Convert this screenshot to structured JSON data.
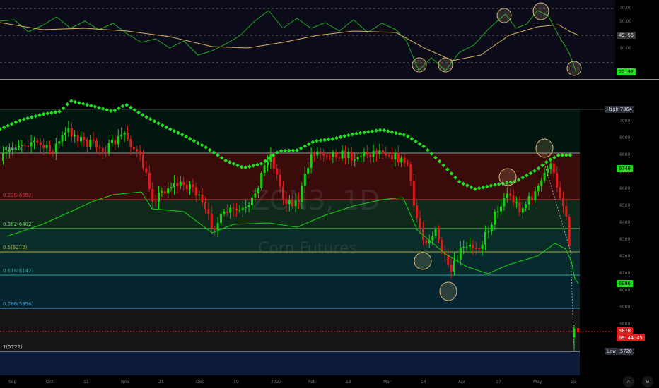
{
  "watermark": {
    "ticker": "ZCN3, 1D",
    "name": "Corn Futures"
  },
  "colors": {
    "up": "#12d512",
    "down": "#e01919",
    "supertrend": "#20e020",
    "rsi": "#22aa22",
    "rsi_ma": "#d9b060",
    "circle": "#d2b87a"
  },
  "fib_levels": [
    {
      "label": "0(6840)",
      "band": "#3a0b0b",
      "line": "#999999"
    },
    {
      "label": "0.236(6562)",
      "band": "#0f2a1b",
      "line": "#cc3a3a"
    },
    {
      "label": "0.382(6402)",
      "band": "#0b2d2a",
      "line": "#6fcf6f"
    },
    {
      "label": "0.5(6272)",
      "band": "#062a2e",
      "line": "#a9a93a"
    },
    {
      "label": "0.618(6142)",
      "band": "#072530",
      "line": "#26a69a"
    },
    {
      "label": "0.786(5956)",
      "band": "#151515",
      "line": "#4d9fcf"
    },
    {
      "label": "1(5722)",
      "band": "#0c1b3a",
      "line": "#cccccc"
    }
  ],
  "right_tags": {
    "high": {
      "name": "High",
      "value": "7064"
    },
    "supertrend_value": "6740",
    "ma_value": "6096",
    "last_price": "5870",
    "countdown": "09:44:45",
    "low": {
      "name": "Low",
      "value": "5720"
    },
    "rsi_ma_value": "49.56",
    "rsi_value": "22.92"
  },
  "price_axis_ticks": [
    "7000",
    "6900",
    "6800",
    "6700",
    "6600",
    "6500",
    "6400",
    "6300",
    "6200",
    "6100",
    "6000",
    "5900",
    "5800"
  ],
  "rsi_axis_ticks": [
    "70.00",
    "50.00",
    "30.00"
  ],
  "time_axis_ticks": [
    "Sep",
    "Oct",
    "11",
    "Nov",
    "21",
    "Dec",
    "19",
    "2023",
    "Feb",
    "13",
    "Mar",
    "14",
    "Apr",
    "17",
    "May",
    "15"
  ],
  "controls": {
    "auto": "A",
    "log": "B"
  }
}
